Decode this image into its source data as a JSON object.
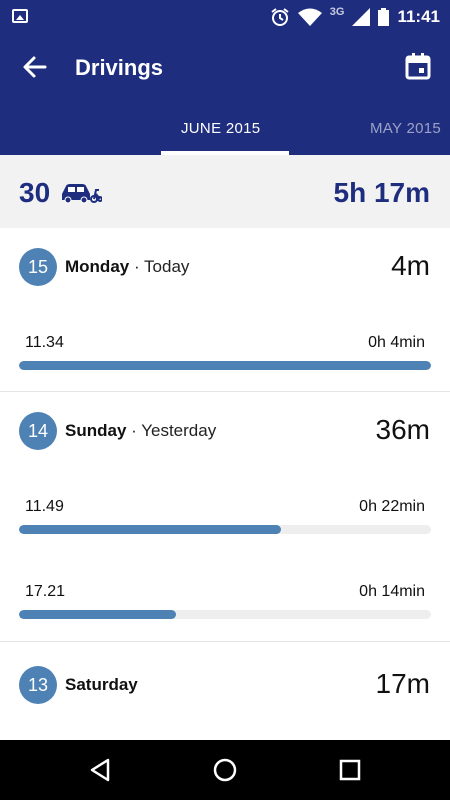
{
  "status_bar": {
    "time": "11:41",
    "network": "3G",
    "icons": [
      "gallery-icon",
      "alarm-icon",
      "wifi-icon",
      "signal-icon",
      "battery-icon"
    ]
  },
  "app_bar": {
    "title": "Drivings",
    "back_icon": "back-arrow-icon",
    "calendar_icon": "calendar-icon",
    "color": "#1f2d7f"
  },
  "tabs": [
    {
      "label": "JUNE 2015",
      "active": true
    },
    {
      "label": "MAY 2015",
      "active": false
    }
  ],
  "summary": {
    "count": "30",
    "vehicle_icon": "car-scooter-icon",
    "total": "5h 17m"
  },
  "days": [
    {
      "number": "15",
      "name": "Monday",
      "relative": " · Today",
      "total": "4m",
      "trips": [
        {
          "time": "11.34",
          "duration": "0h 4min",
          "progress": 1.0
        }
      ]
    },
    {
      "number": "14",
      "name": "Sunday",
      "relative": " · Yesterday",
      "total": "36m",
      "trips": [
        {
          "time": "11.49",
          "duration": "0h 22min",
          "progress": 0.636
        },
        {
          "time": "17.21",
          "duration": "0h 14min",
          "progress": 0.38
        }
      ]
    },
    {
      "number": "13",
      "name": "Saturday",
      "relative": "",
      "total": "17m",
      "trips": []
    }
  ],
  "accent_color": "#4f82b4",
  "nav": [
    "back-triangle-icon",
    "home-circle-icon",
    "recents-square-icon"
  ]
}
